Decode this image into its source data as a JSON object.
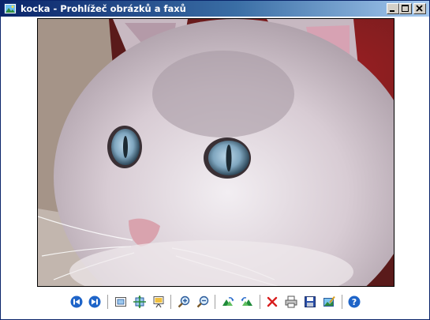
{
  "window": {
    "title": "kocka - Prohlížeč obrázků a faxů",
    "image_subject": "cat-photo"
  },
  "toolbar": {
    "buttons": [
      {
        "icon": "previous-image-icon"
      },
      {
        "icon": "next-image-icon"
      },
      {
        "icon": "best-fit-icon"
      },
      {
        "icon": "actual-size-icon"
      },
      {
        "icon": "slideshow-icon"
      },
      {
        "icon": "zoom-in-icon"
      },
      {
        "icon": "zoom-out-icon"
      },
      {
        "icon": "rotate-clockwise-icon"
      },
      {
        "icon": "rotate-counterclockwise-icon"
      },
      {
        "icon": "delete-icon"
      },
      {
        "icon": "print-icon"
      },
      {
        "icon": "save-icon"
      },
      {
        "icon": "open-for-editing-icon"
      },
      {
        "icon": "help-icon"
      }
    ]
  },
  "colors": {
    "titlebar_start": "#0a246a",
    "titlebar_end": "#a6caf0",
    "accent_blue": "#1e64c8",
    "delete_red": "#d81e1e",
    "rotate_green": "#1f8a3a"
  }
}
